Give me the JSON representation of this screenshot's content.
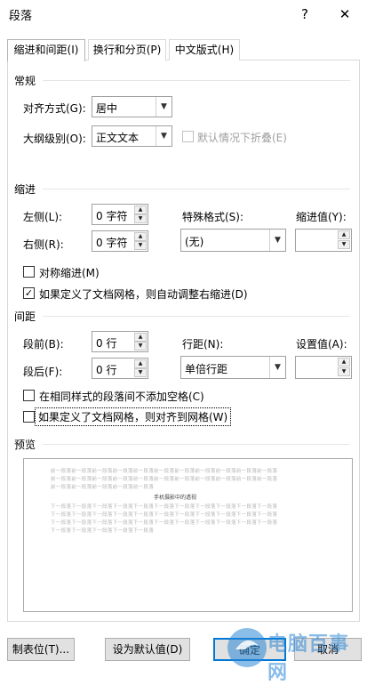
{
  "window": {
    "title": "段落",
    "help": "?",
    "close": "✕"
  },
  "tabs": [
    {
      "label": "缩进和间距(I)"
    },
    {
      "label": "换行和分页(P)"
    },
    {
      "label": "中文版式(H)"
    }
  ],
  "general": {
    "section": "常规",
    "alignment_label": "对齐方式(G):",
    "alignment_value": "居中",
    "outline_label": "大纲级别(O):",
    "outline_value": "正文文本",
    "collapse_label": "默认情况下折叠(E)"
  },
  "indent": {
    "section": "缩进",
    "left_label": "左侧(L):",
    "left_value": "0 字符",
    "right_label": "右侧(R):",
    "right_value": "0 字符",
    "special_label": "特殊格式(S):",
    "special_value": "(无)",
    "by_label": "缩进值(Y):",
    "by_value": "",
    "mirror_label": "对称缩进(M)",
    "mirror_checked": false,
    "auto_adjust_label": "如果定义了文档网格，则自动调整右缩进(D)",
    "auto_adjust_checked": true
  },
  "spacing": {
    "section": "间距",
    "before_label": "段前(B):",
    "before_value": "0 行",
    "after_label": "段后(F):",
    "after_value": "0 行",
    "line_label": "行距(N):",
    "line_value": "单倍行距",
    "at_label": "设置值(A):",
    "at_value": "",
    "no_space_label": "在相同样式的段落间不添加空格(C)",
    "no_space_checked": false,
    "snap_grid_label": "如果定义了文档网格，则对齐到网格(W)",
    "snap_grid_checked": false
  },
  "preview": {
    "section": "预览",
    "prev_lines": [
      "前一段落前一段落前一段落前一段落前一段落前一段落前一段落前一段落前一段落前一段落前一段落",
      "前一段落前一段落前一段落前一段落前一段落前一段落前一段落前一段落前一段落前一段落前一段落",
      "前一段落前一段落前一段落前一段落前一段落"
    ],
    "main_line": "手机摄影中的透视",
    "next_lines": [
      "下一段落下一段落下一段落下一段落下一段落下一段落下一段落下一段落下一段落下一段落下一段落",
      "下一段落下一段落下一段落下一段落下一段落下一段落下一段落下一段落下一段落下一段落下一段落",
      "下一段落下一段落下一段落下一段落下一段落下一段落下一段落下一段落下一段落下一段落下一段落",
      "下一段落下一段落下一段落下一段落下一段落"
    ]
  },
  "buttons": {
    "tabs": "制表位(T)...",
    "default": "设为默认值(D)",
    "ok": "确定",
    "cancel": "取消"
  },
  "watermark": "电脑百事网"
}
